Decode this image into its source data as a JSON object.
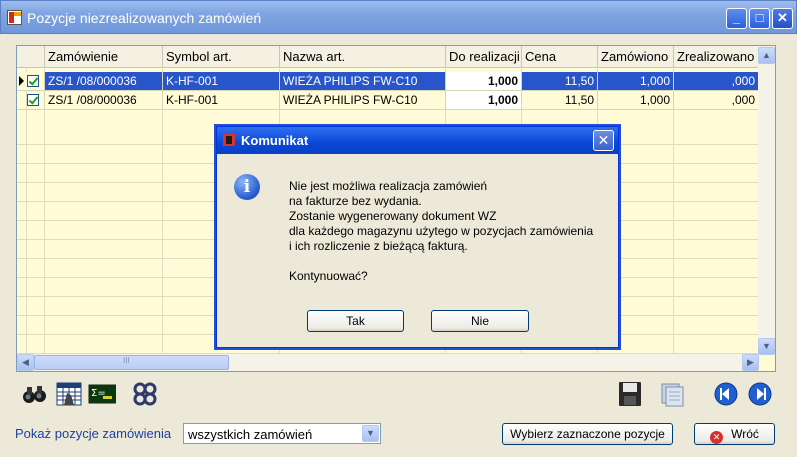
{
  "window": {
    "title": "Pozycje niezrealizowanych zamówień"
  },
  "grid": {
    "columns": [
      "Zamówienie",
      "Symbol art.",
      "Nazwa art.",
      "Do realizacji",
      "Cena",
      "Zamówiono",
      "Zrealizowano"
    ],
    "rows": [
      {
        "checked": true,
        "zamowienie": "ZS/1  /08/000036",
        "symbol": "K-HF-001",
        "nazwa": "WIEŻA PHILIPS FW-C10",
        "do_realizacji": "1,000",
        "cena": "11,50",
        "zamowiono": "1,000",
        "zrealizowano": ",000",
        "selected": true
      },
      {
        "checked": true,
        "zamowienie": "ZS/1  /08/000036",
        "symbol": "K-HF-001",
        "nazwa": "WIEŻA PHILIPS FW-C10",
        "do_realizacji": "1,000",
        "cena": "11,50",
        "zamowiono": "1,000",
        "zrealizowano": ",000",
        "selected": false
      }
    ],
    "scroll_thumb_label": "III"
  },
  "toolbar": {
    "icons": [
      "binoculars-icon",
      "table-icon",
      "sum-icon",
      "link-icon",
      "save-icon",
      "copy-icon",
      "prev-icon",
      "next-icon"
    ]
  },
  "bottom": {
    "filter_label": "Pokaż pozycje zamówienia",
    "filter_value": "wszystkich zamówień",
    "select_button": "Wybierz zaznaczone pozycje",
    "back_button": "Wróć"
  },
  "dialog": {
    "title": "Komunikat",
    "message": "Nie jest możliwa realizacja zamówień\nna fakturze bez wydania.\nZostanie wygenerowany dokument WZ\ndla każdego magazynu użytego w pozycjach zamówienia\ni ich rozliczenie z bieżącą fakturą.\n\nKontynuować?",
    "yes_button": "Tak",
    "no_button": "Nie"
  },
  "colors": {
    "titlebar": "#7fa4e0",
    "dialog_titlebar": "#0a47d8",
    "grid_bg": "#fffbd6",
    "selection": "#2855c9"
  }
}
